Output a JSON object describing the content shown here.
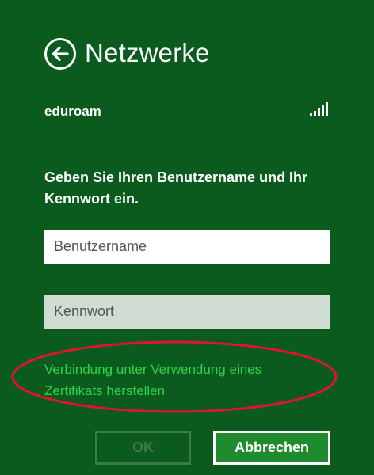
{
  "header": {
    "title": "Netzwerke",
    "back_icon": "back-arrow-circle-icon"
  },
  "network": {
    "name": "eduroam",
    "signal_icon": "signal-strength-icon",
    "signal_bars": 5,
    "signal_level": "5/5"
  },
  "form": {
    "prompt": "Geben Sie Ihren Benutzername und Ihr Kennwort ein.",
    "username_placeholder": "Benutzername",
    "username_value": "",
    "password_placeholder": "Kennwort",
    "password_value": ""
  },
  "certificate_link": {
    "label": "Verbindung unter Verwendung eines Zertifikats herstellen"
  },
  "buttons": {
    "ok_label": "OK",
    "ok_enabled": false,
    "cancel_label": "Abbrechen"
  },
  "colors": {
    "background": "#0b5a1e",
    "link": "#2fd34a",
    "highlight_ellipse": "#e0152b",
    "cancel_button": "#1f8a2e",
    "disabled": "#3d7a4c"
  }
}
